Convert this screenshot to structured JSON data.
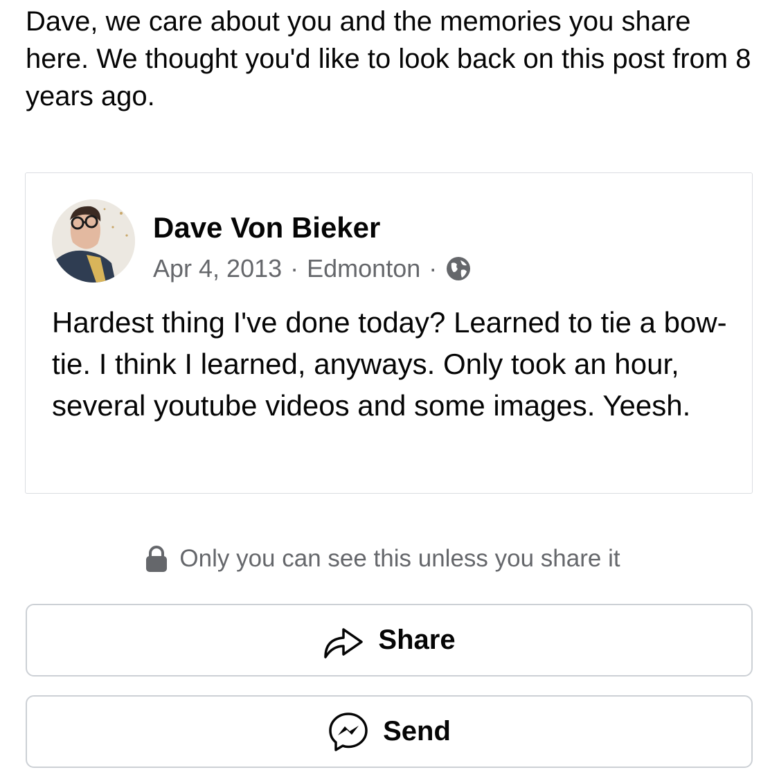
{
  "memory": {
    "intro_text": "Dave, we care about you and the memories you share here. We thought you'd like to look back on this post from 8 years ago."
  },
  "post": {
    "author": "Dave Von Bieker",
    "date": "Apr 4, 2013",
    "separator": "·",
    "location": "Edmonton",
    "audience_icon": "globe-icon",
    "text": "Hardest thing I've done today? Learned to tie a bow-tie. I think I learned, anyways. Only took an hour, several youtube videos and some images. Yeesh."
  },
  "privacy": {
    "icon": "lock-icon",
    "text": "Only you can see this unless you share it"
  },
  "actions": {
    "share_label": "Share",
    "share_icon": "share-arrow-icon",
    "send_label": "Send",
    "send_icon": "messenger-icon"
  },
  "colors": {
    "primary_text": "#050505",
    "secondary_text": "#65676b",
    "border": "#ccd0d5"
  }
}
